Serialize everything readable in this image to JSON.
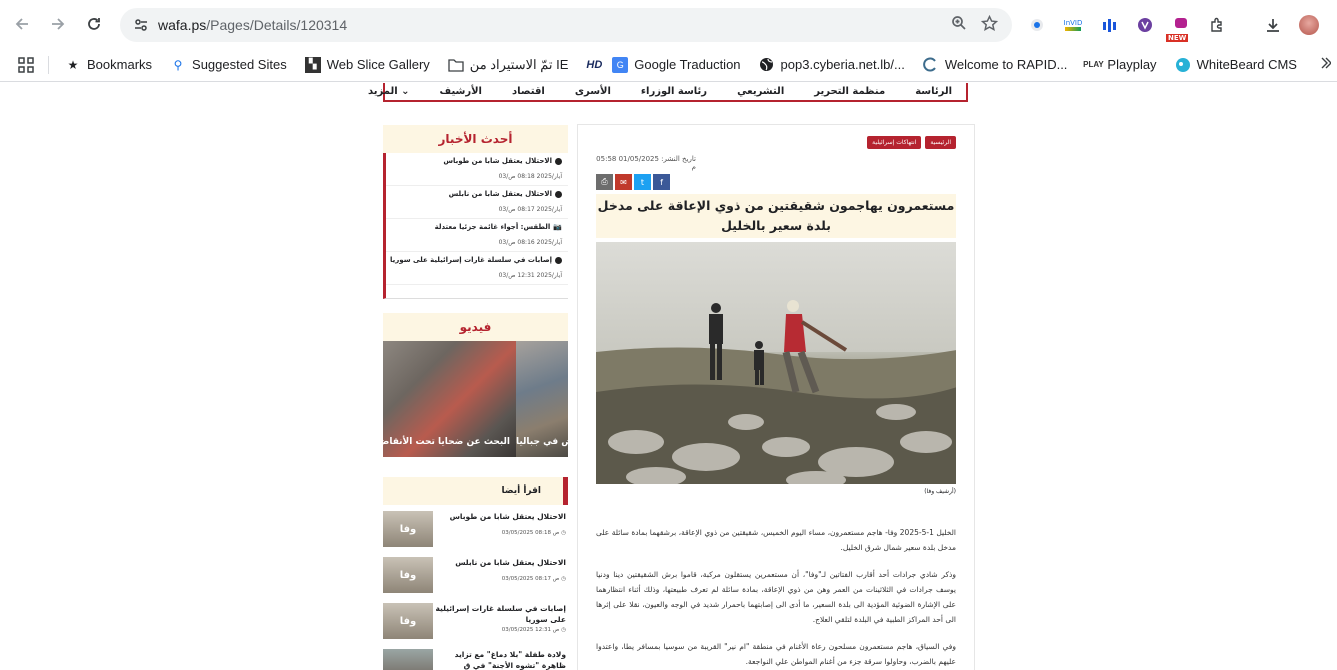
{
  "browser": {
    "url_host": "wafa.ps",
    "url_path": "/Pages/Details/120314"
  },
  "bookmarks": [
    {
      "label": "Bookmarks",
      "icon": "star-icon"
    },
    {
      "label": "Suggested Sites",
      "icon": "search-icon"
    },
    {
      "label": "Web Slice Gallery",
      "icon": "web-slice-icon"
    },
    {
      "label": "تمّ الاستيراد من IE",
      "icon": "folder-icon"
    },
    {
      "label": "",
      "icon": "hd-icon"
    },
    {
      "label": "Google Traduction",
      "icon": "translate-icon"
    },
    {
      "label": "pop3.cyberia.net.lb/...",
      "icon": "globe-icon"
    },
    {
      "label": "Welcome to RAPID...",
      "icon": "rapid-icon"
    },
    {
      "label": "Playplay",
      "icon": "playplay-icon"
    },
    {
      "label": "WhiteBeard CMS",
      "icon": "whitebeard-icon"
    }
  ],
  "hd_badge": "HD",
  "invid_badge": "InVID",
  "new_badge": "NEW",
  "sitenav": [
    "الرئاسة",
    "منظمة التحرير",
    "التشريعي",
    "رئاسة الوزراء",
    "الأسرى",
    "اقتصاد",
    "الأرشيف",
    "المزيد"
  ],
  "latest": {
    "heading": "أحدث الأخبار",
    "items": [
      {
        "title": "الاحتلال يعتقل شابا من طوباس",
        "date": "03/آيار/2025 08:18 ص"
      },
      {
        "title": "الاحتلال يعتقل شابا من نابلس",
        "date": "03/آيار/2025 08:17 ص"
      },
      {
        "title": "الطقس: أجواء غائمة جزئيا معتدلة",
        "date": "03/آيار/2025 08:16 ص"
      },
      {
        "title": "إصابات في سلسلة غارات إسرائيلية على سوريا",
        "date": "03/آيار/2025 12:31 ص"
      }
    ]
  },
  "video": {
    "heading": "فيديو",
    "captions": [
      "البحث عن ضحايا تحت الأنقاض",
      "اض في جباليا"
    ]
  },
  "also": {
    "heading": "اقرأ أيضا",
    "thumb_text": "وفا",
    "items": [
      {
        "title": "الاحتلال يعتقل شابا من طوباس",
        "date": "03/05/2025 08:18 ص"
      },
      {
        "title": "الاحتلال يعتقل شابا من نابلس",
        "date": "03/05/2025 08:17 ص"
      },
      {
        "title": "إصابات في سلسلة غارات إسرائيلية على سوريا",
        "date": "03/05/2025 12:31 ص"
      },
      {
        "title": "ولادة طفلة \"بلا دماغ\" مع تزايد ظاهرة \"تشوه الأجنة\" في ق",
        "date": ""
      }
    ]
  },
  "article": {
    "categories": [
      "الرئيسية",
      "انتهاكات إسرائيلية"
    ],
    "date": "تاريخ النشر: 01/05/2025 05:58 م",
    "title": "مستعمرون يهاجمون شقيقتين من ذوي الإعاقة على مدخل بلدة سعير بالخليل",
    "credit": "(أرشيف وفا)",
    "paragraphs": [
      "الخليل 1-5-2025 وفا- هاجم مستعمرون، مساء اليوم الخميس، شقيقتين من ذوي الإعاقة، برشقهما بمادة سائلة على مدخل بلدة سعير شمال شرق الخليل.",
      "وذكر شادي جرادات أحد أقارب الفتاتين لـ\"وفا\"، أن مستعمرين يستقلون مركبة، قاموا برش الشقيقتين دينا ودنيا يوسف جرادات في الثلاثينات من العمر وهن من ذوي الإعاقة، بمادة سائلة لم تعرف طبيعتها، وذلك أثناء انتظارهما على الإشارة الضوئية المؤدية الى بلدة السعير، ما أدى الى إصابتهما باحمرار شديد في الوجه والعيون، نقلا على إثرها الى أحد المراكز الطبية في البلدة لتلقي العلاج.",
      "وفي السياق، هاجم مستعمرون مسلحون رعاة الأغنام في منطقة \"ام نير\" القريبة من سوسيا بمسافر يطا، واعتدوا عليهم بالضرب، وحاولوا سرقة جزء من أغنام المواطن علي النواجعة."
    ]
  },
  "colors": {
    "brand_red": "#b5232f",
    "cream": "#fdf6e3"
  }
}
